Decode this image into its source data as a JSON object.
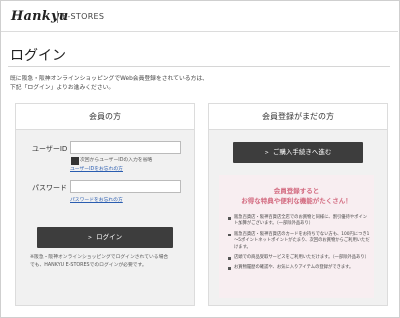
{
  "header": {
    "logo": "Hankyu",
    "logo_sub": "E-STORES"
  },
  "page_title": "ログイン",
  "intro": [
    "既に阪急・阪神オンラインショッピングでWeb会員登録をされている方は、",
    "下記「ログイン」よりお進みください。"
  ],
  "member_panel": {
    "heading": "会員の方",
    "user_id_label": "ユーザーID",
    "user_id_value": "",
    "remember_label": "次回からユーザーIDの入力を省略",
    "forgot_id_link": "ユーザーIDをお忘れの方",
    "password_label": "パスワード",
    "password_value": "",
    "forgot_password_link": "パスワードをお忘れの方",
    "login_button": "ログイン",
    "note": [
      "※阪急・阪神オンラインショッピングでログインされている場合",
      "でも、HANKYU E-STORESでのログインが必要です。"
    ]
  },
  "guest_panel": {
    "heading": "会員登録がまだの方",
    "register_button": "ご購入手続きへ進む",
    "promo_title": [
      "会員登録すると",
      "お得な特典や便利な機能がたくさん！"
    ],
    "bullets": [
      "阪急百貨店・阪神百貨店全店でのお買物と同様に、割引優待やポイント加算がございます。（一部除外品あり）",
      "阪急百貨店・阪神百貨店のカードをお持ちでない方も、100円につき1～5ポイントネットポイントがたまり、次回のお買物からご利用いただけます。",
      "店頭での商品受取サービスをご利用いただけます。（一部除外品あり）",
      "お買物履歴の確認や、お気に入りアイテムの登録ができます。"
    ]
  },
  "colors": {
    "button_bg": "#3d3d3d",
    "promo_bg": "#f8eef1",
    "promo_text": "#d36b80",
    "link": "#2a5db0"
  }
}
